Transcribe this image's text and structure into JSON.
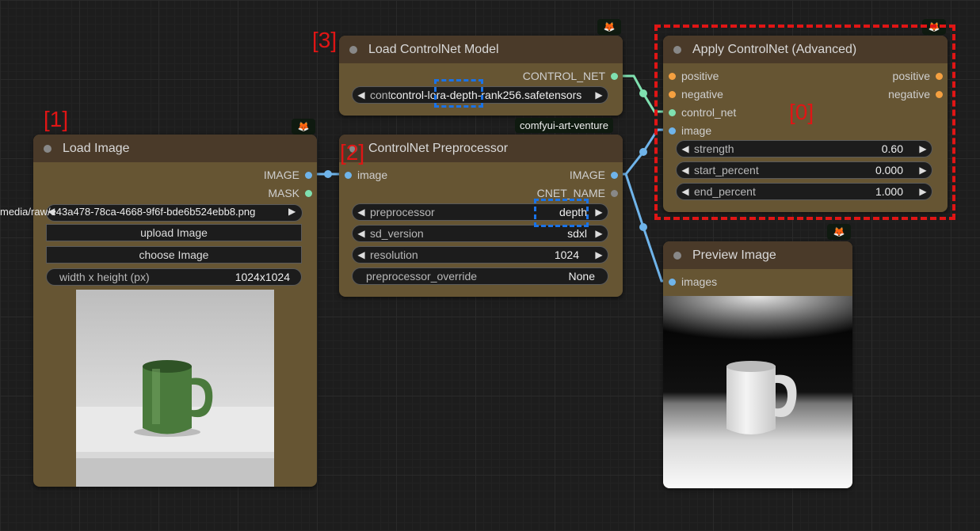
{
  "annotations": [
    "[0]",
    "[1]",
    "[2]",
    "[3]"
  ],
  "brand_color": "#665533",
  "highlight_color": "#e01515",
  "load_image": {
    "title": "Load Image",
    "outputs": [
      "IMAGE",
      "MASK"
    ],
    "image_value": "media/raw/e43a478-78ca-4668-9f6f-bde6b524ebb8.png",
    "upload_label": "upload Image",
    "choose_label": "choose Image",
    "size_label": "width x height (px)",
    "size_value": "1024x1024",
    "preview_desc": "green mug on white table"
  },
  "controlnet_model": {
    "title": "Load ControlNet Model",
    "output": "CONTROL_NET",
    "widget_label": "cont",
    "widget_value": "control-lora-depth-rank256.safetensors"
  },
  "preprocessor": {
    "title": "ControlNet Preprocessor",
    "tag": "comfyui-art-venture",
    "input": "image",
    "outputs": [
      "IMAGE",
      "CNET_NAME"
    ],
    "widgets": [
      {
        "label": "preprocessor",
        "value": "depth"
      },
      {
        "label": "sd_version",
        "value": "sdxl"
      },
      {
        "label": "resolution",
        "value": "1024"
      },
      {
        "label": "preprocessor_override",
        "value": "None"
      }
    ]
  },
  "apply_controlnet": {
    "title": "Apply ControlNet (Advanced)",
    "inputs": [
      "positive",
      "negative",
      "control_net",
      "image"
    ],
    "outputs": [
      "positive",
      "negative"
    ],
    "widgets": [
      {
        "label": "strength",
        "value": "0.60"
      },
      {
        "label": "start_percent",
        "value": "0.000"
      },
      {
        "label": "end_percent",
        "value": "1.000"
      }
    ]
  },
  "preview_image": {
    "title": "Preview Image",
    "input": "images"
  },
  "icons": {
    "badge": "fox-icon",
    "collapse": "node-dot-icon",
    "arrow_left": "◀",
    "arrow_right": "▶"
  }
}
